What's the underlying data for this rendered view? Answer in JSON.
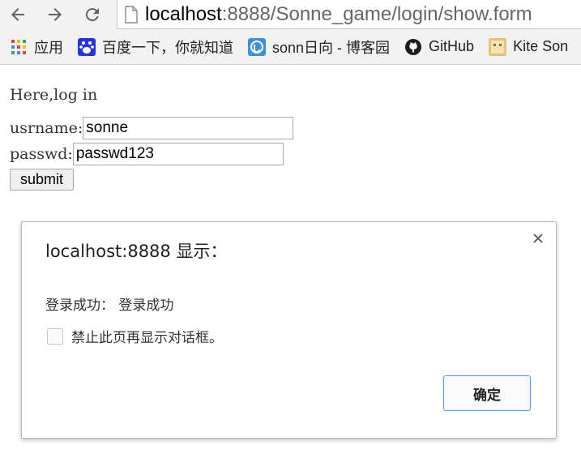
{
  "browser": {
    "nav": {
      "back_icon": "arrow-left-icon",
      "forward_icon": "arrow-right-icon",
      "reload_icon": "reload-icon"
    },
    "address": {
      "host": "localhost",
      "path": ":8888/Sonne_game/login/show.form"
    },
    "bookmarks": [
      {
        "label": "应用",
        "icon": "apps-grid-icon"
      },
      {
        "label": "百度一下，你就知道",
        "icon": "baidu-paw-icon"
      },
      {
        "label": "sonn日向 - 博客园",
        "icon": "cnblogs-icon"
      },
      {
        "label": "GitHub",
        "icon": "github-icon"
      },
      {
        "label": "Kite Son",
        "icon": "kite-icon"
      }
    ]
  },
  "page": {
    "intro": "Here,log in",
    "username_label": "usrname:",
    "username_value": "sonne",
    "password_label": "passwd:",
    "password_value": "passwd123",
    "submit_label": "submit"
  },
  "dialog": {
    "title": "localhost:8888 显示：",
    "message": "登录成功： 登录成功",
    "suppress_label": "禁止此页再显示对话框。",
    "ok_label": "确定",
    "accent_color": "#4d90fe"
  }
}
